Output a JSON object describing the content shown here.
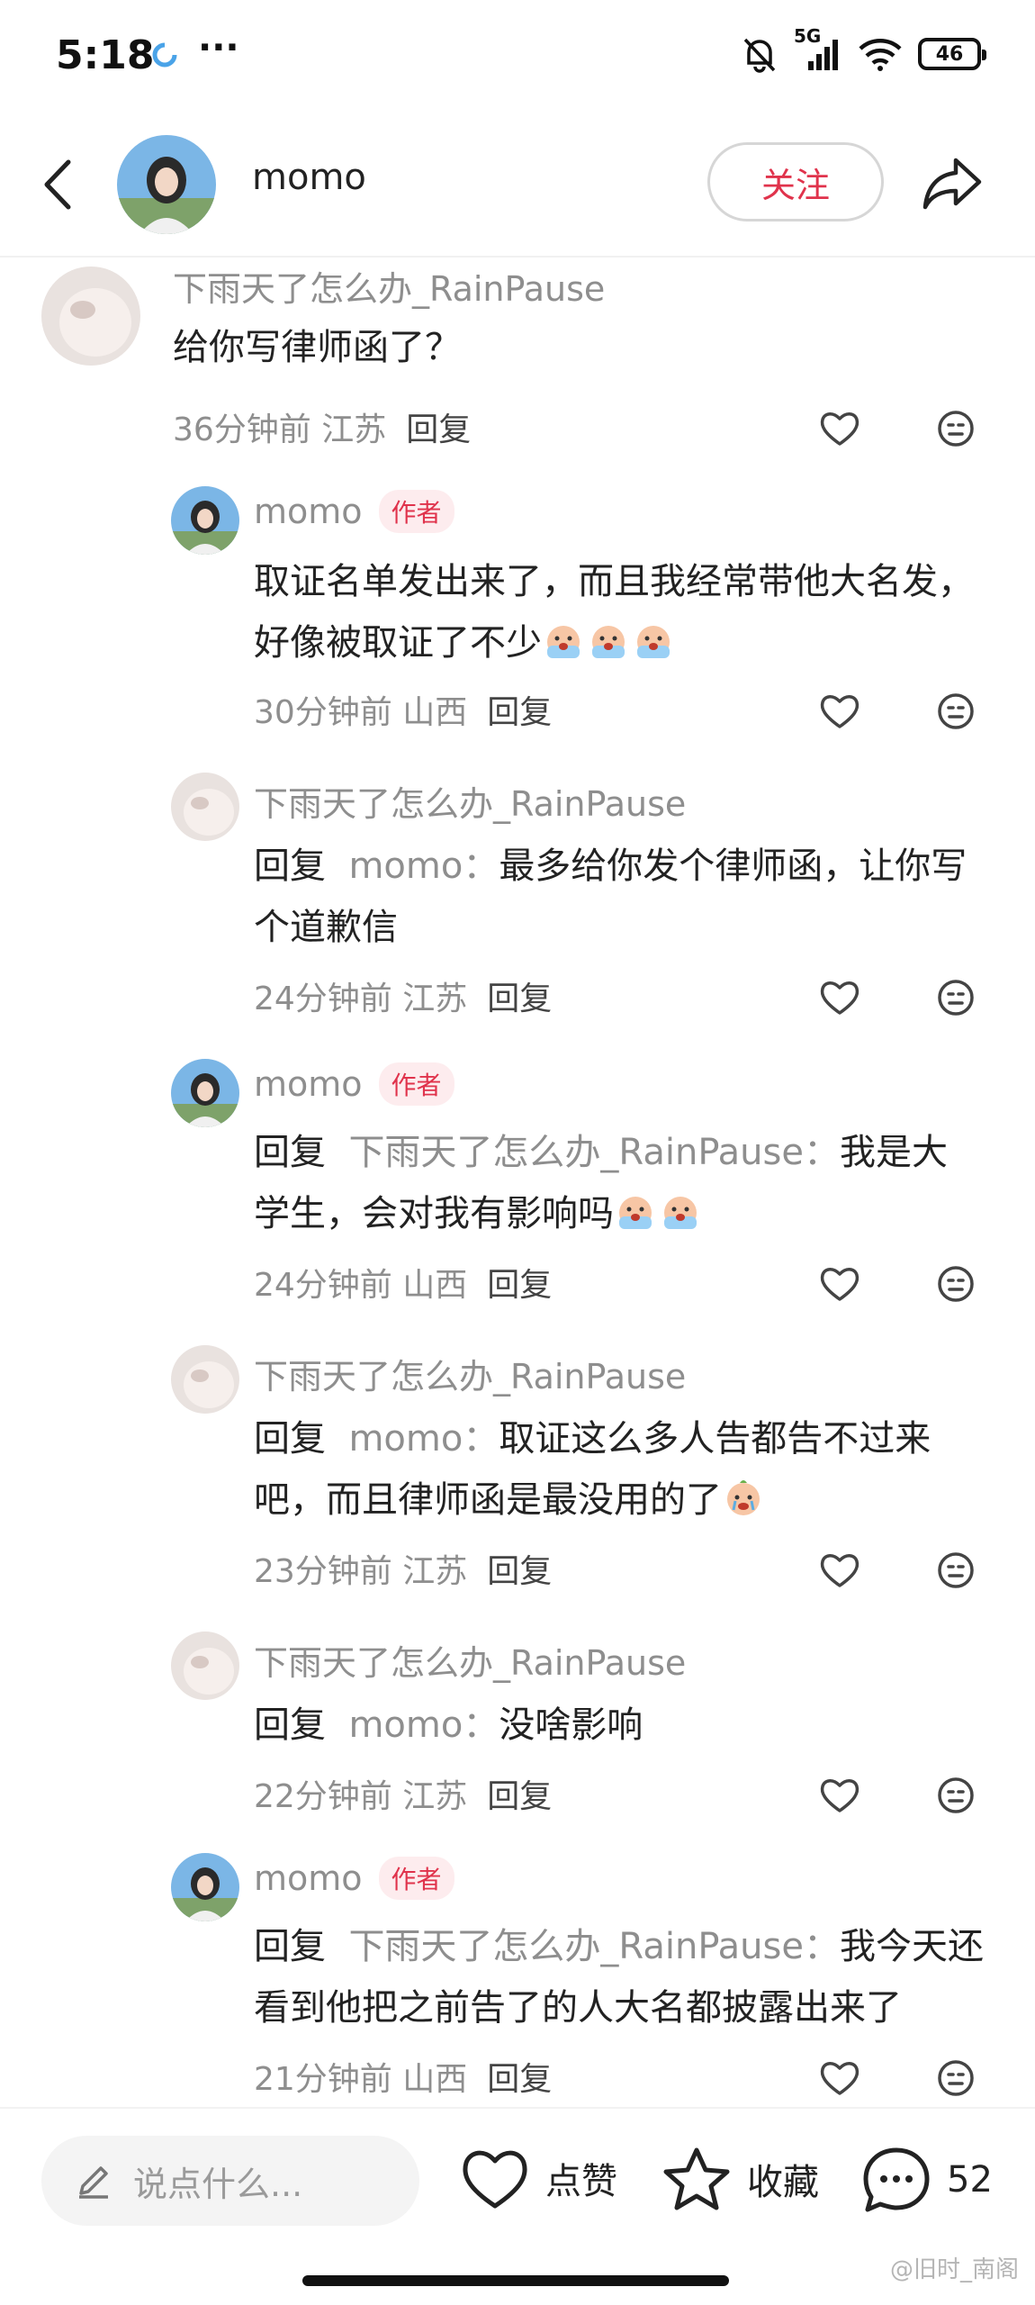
{
  "status_bar": {
    "time": "5:18",
    "network": "5G",
    "battery": "46"
  },
  "header": {
    "username": "momo",
    "follow_label": "关注"
  },
  "comments": [
    {
      "user": "下雨天了怎么办_RainPause",
      "badge": "",
      "reply_prefix": "",
      "reply_to": "",
      "text": "给你写律师函了？",
      "time": "36分钟前",
      "location": "江苏",
      "reply_label": "回复"
    },
    {
      "user": "momo",
      "badge": "作者",
      "reply_prefix": "",
      "reply_to": "",
      "text": "取证名单发出来了，而且我经常带他大名发，好像被取证了不少",
      "time": "30分钟前",
      "location": "山西",
      "reply_label": "回复"
    },
    {
      "user": "下雨天了怎么办_RainPause",
      "badge": "",
      "reply_prefix": "回复",
      "reply_to": "momo：",
      "text": "最多给你发个律师函，让你写个道歉信",
      "time": "24分钟前",
      "location": "江苏",
      "reply_label": "回复"
    },
    {
      "user": "momo",
      "badge": "作者",
      "reply_prefix": "回复",
      "reply_to": "下雨天了怎么办_RainPause：",
      "text": "我是大学生，会对我有影响吗",
      "time": "24分钟前",
      "location": "山西",
      "reply_label": "回复"
    },
    {
      "user": "下雨天了怎么办_RainPause",
      "badge": "",
      "reply_prefix": "回复",
      "reply_to": "momo：",
      "text": "取证这么多人告都告不过来吧，而且律师函是最没用的了",
      "time": "23分钟前",
      "location": "江苏",
      "reply_label": "回复"
    },
    {
      "user": "下雨天了怎么办_RainPause",
      "badge": "",
      "reply_prefix": "回复",
      "reply_to": "momo：",
      "text": "没啥影响",
      "time": "22分钟前",
      "location": "江苏",
      "reply_label": "回复"
    },
    {
      "user": "momo",
      "badge": "作者",
      "reply_prefix": "回复",
      "reply_to": "下雨天了怎么办_RainPause：",
      "text": "我今天还看到他把之前告了的人大名都披露出来了",
      "time": "21分钟前",
      "location": "山西",
      "reply_label": "回复"
    }
  ],
  "bottom_bar": {
    "input_placeholder": "说点什么...",
    "like_label": "点赞",
    "collect_label": "收藏",
    "comment_count": "52"
  },
  "watermark": "@旧时_南阁",
  "colors": {
    "accent": "#e0334c",
    "muted": "#8e8e8e"
  }
}
